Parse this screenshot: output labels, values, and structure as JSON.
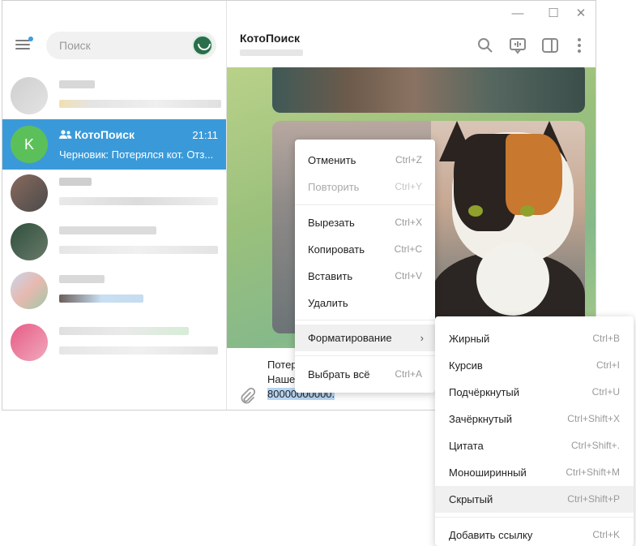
{
  "window": {
    "controls": {
      "minimize": "—",
      "maximize": "☐",
      "close": "✕"
    }
  },
  "sidebar": {
    "search_placeholder": "Поиск",
    "chats": [
      {
        "name": "КотоПоиск",
        "avatar_letter": "K",
        "time": "21:11",
        "preview": "Черновик: Потерялся кот. Отз...",
        "active": true
      }
    ]
  },
  "chat": {
    "title": "КотоПоиск",
    "composer_lines": [
      "Потер",
      "Наше",
      "80000000000."
    ]
  },
  "context_menu": {
    "items": [
      {
        "label": "Отменить",
        "shortcut": "Ctrl+Z",
        "enabled": true
      },
      {
        "label": "Повторить",
        "shortcut": "Ctrl+Y",
        "enabled": false
      },
      {
        "label": "Вырезать",
        "shortcut": "Ctrl+X",
        "enabled": true
      },
      {
        "label": "Копировать",
        "shortcut": "Ctrl+C",
        "enabled": true
      },
      {
        "label": "Вставить",
        "shortcut": "Ctrl+V",
        "enabled": true
      },
      {
        "label": "Удалить",
        "shortcut": "",
        "enabled": true
      },
      {
        "label": "Форматирование",
        "shortcut": "›",
        "enabled": true
      },
      {
        "label": "Выбрать всё",
        "shortcut": "Ctrl+A",
        "enabled": true
      }
    ]
  },
  "format_menu": {
    "items": [
      {
        "label": "Жирный",
        "shortcut": "Ctrl+B"
      },
      {
        "label": "Курсив",
        "shortcut": "Ctrl+I"
      },
      {
        "label": "Подчёркнутый",
        "shortcut": "Ctrl+U"
      },
      {
        "label": "Зачёркнутый",
        "shortcut": "Ctrl+Shift+X"
      },
      {
        "label": "Цитата",
        "shortcut": "Ctrl+Shift+."
      },
      {
        "label": "Моноширинный",
        "shortcut": "Ctrl+Shift+M"
      },
      {
        "label": "Скрытый",
        "shortcut": "Ctrl+Shift+P"
      },
      {
        "label": "Добавить ссылку",
        "shortcut": "Ctrl+K"
      }
    ]
  },
  "colors": {
    "accent": "#3a9ad9",
    "avatar_k": "#5cc05a"
  }
}
